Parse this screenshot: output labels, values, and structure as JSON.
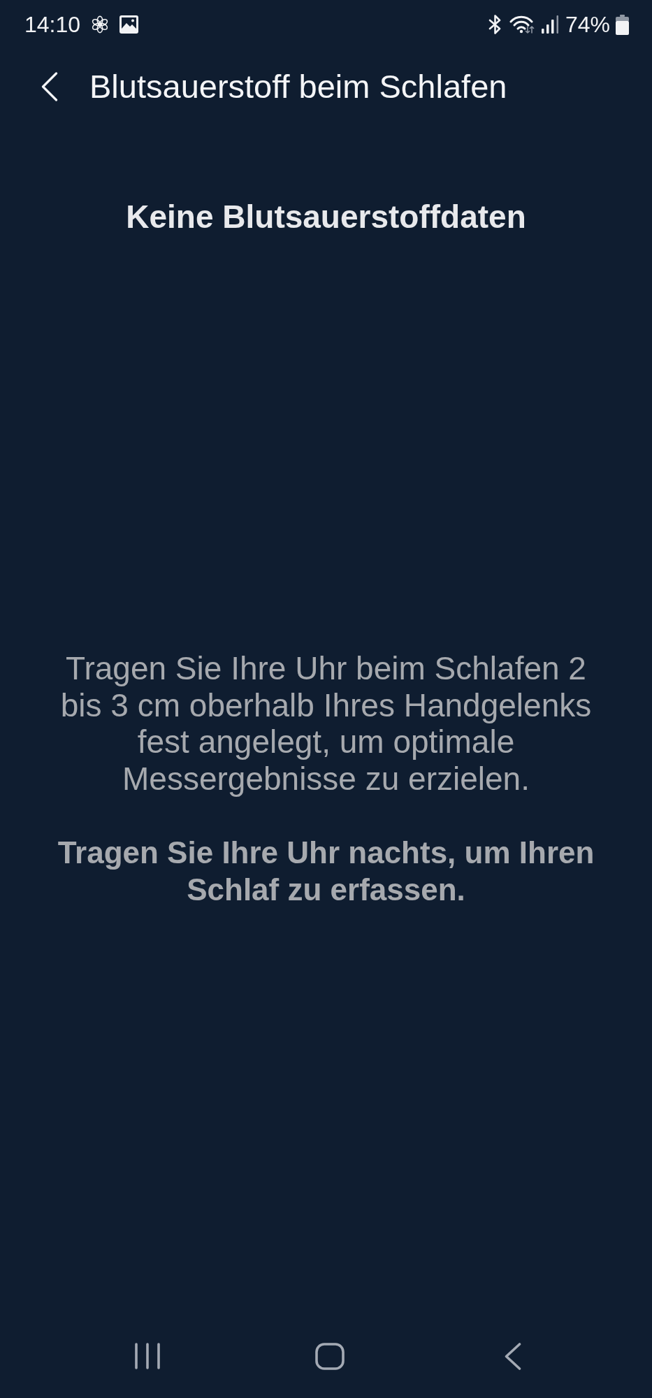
{
  "status_bar": {
    "time": "14:10",
    "battery": "74%"
  },
  "header": {
    "title": "Blutsauerstoff beim Schlafen"
  },
  "content": {
    "heading": "Keine Blutsauerstoffdaten",
    "paragraphs": [
      {
        "kind": "normal",
        "text": "Tragen Sie Ihre Uhr beim Schlafen 2 bis 3 cm oberhalb Ihres Handgelenks fest angelegt, um optimale Messergebnisse zu erzielen."
      },
      {
        "kind": "bold",
        "text": "Tragen Sie Ihre Uhr nachts, um Ihren Schlaf zu erfassen."
      }
    ]
  }
}
